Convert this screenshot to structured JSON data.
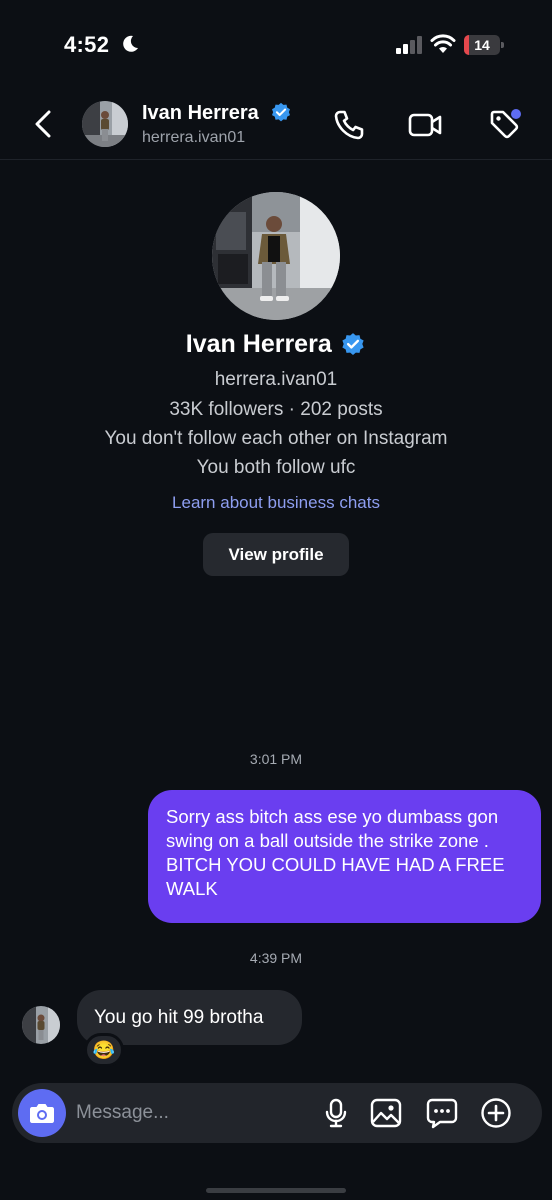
{
  "status_bar": {
    "time": "4:52",
    "battery_level": "14",
    "icons": [
      "moon-icon",
      "signal-icon",
      "wifi-icon",
      "battery-icon"
    ]
  },
  "header": {
    "name": "Ivan Herrera",
    "username": "herrera.ivan01",
    "icons": [
      "back-chevron-icon",
      "phone-icon",
      "video-camera-icon",
      "tag-icon"
    ],
    "tag_dot_color": "#5e6cf2"
  },
  "profile": {
    "name": "Ivan Herrera",
    "username": "herrera.ivan01",
    "stats": "33K followers · 202 posts",
    "follow_status": "You don't follow each other on Instagram",
    "mutual": "You both follow ufc",
    "business_link": "Learn about business chats",
    "view_profile_label": "View profile"
  },
  "messages": [
    {
      "timestamp": "3:01 PM",
      "direction": "sent",
      "text": "Sorry ass bitch ass ese yo dumbass gon swing on a ball outside the strike zone . BITCH YOU COULD HAVE HAD A FREE WALK"
    },
    {
      "timestamp": "4:39 PM",
      "direction": "received",
      "text": "You go hit 99 brotha",
      "reaction": "😂"
    }
  ],
  "composer": {
    "placeholder": "Message...",
    "icons": [
      "camera-icon",
      "microphone-icon",
      "gallery-icon",
      "sticker-icon",
      "plus-icon"
    ]
  },
  "colors": {
    "background": "#0c0f14",
    "sent_bubble": "#6a3ef0",
    "received_bubble": "#25282e",
    "verified_badge": "#3897f0",
    "link": "#8e9ef0",
    "camera_button": "#5e6cf2",
    "battery_low": "#e5484d"
  }
}
